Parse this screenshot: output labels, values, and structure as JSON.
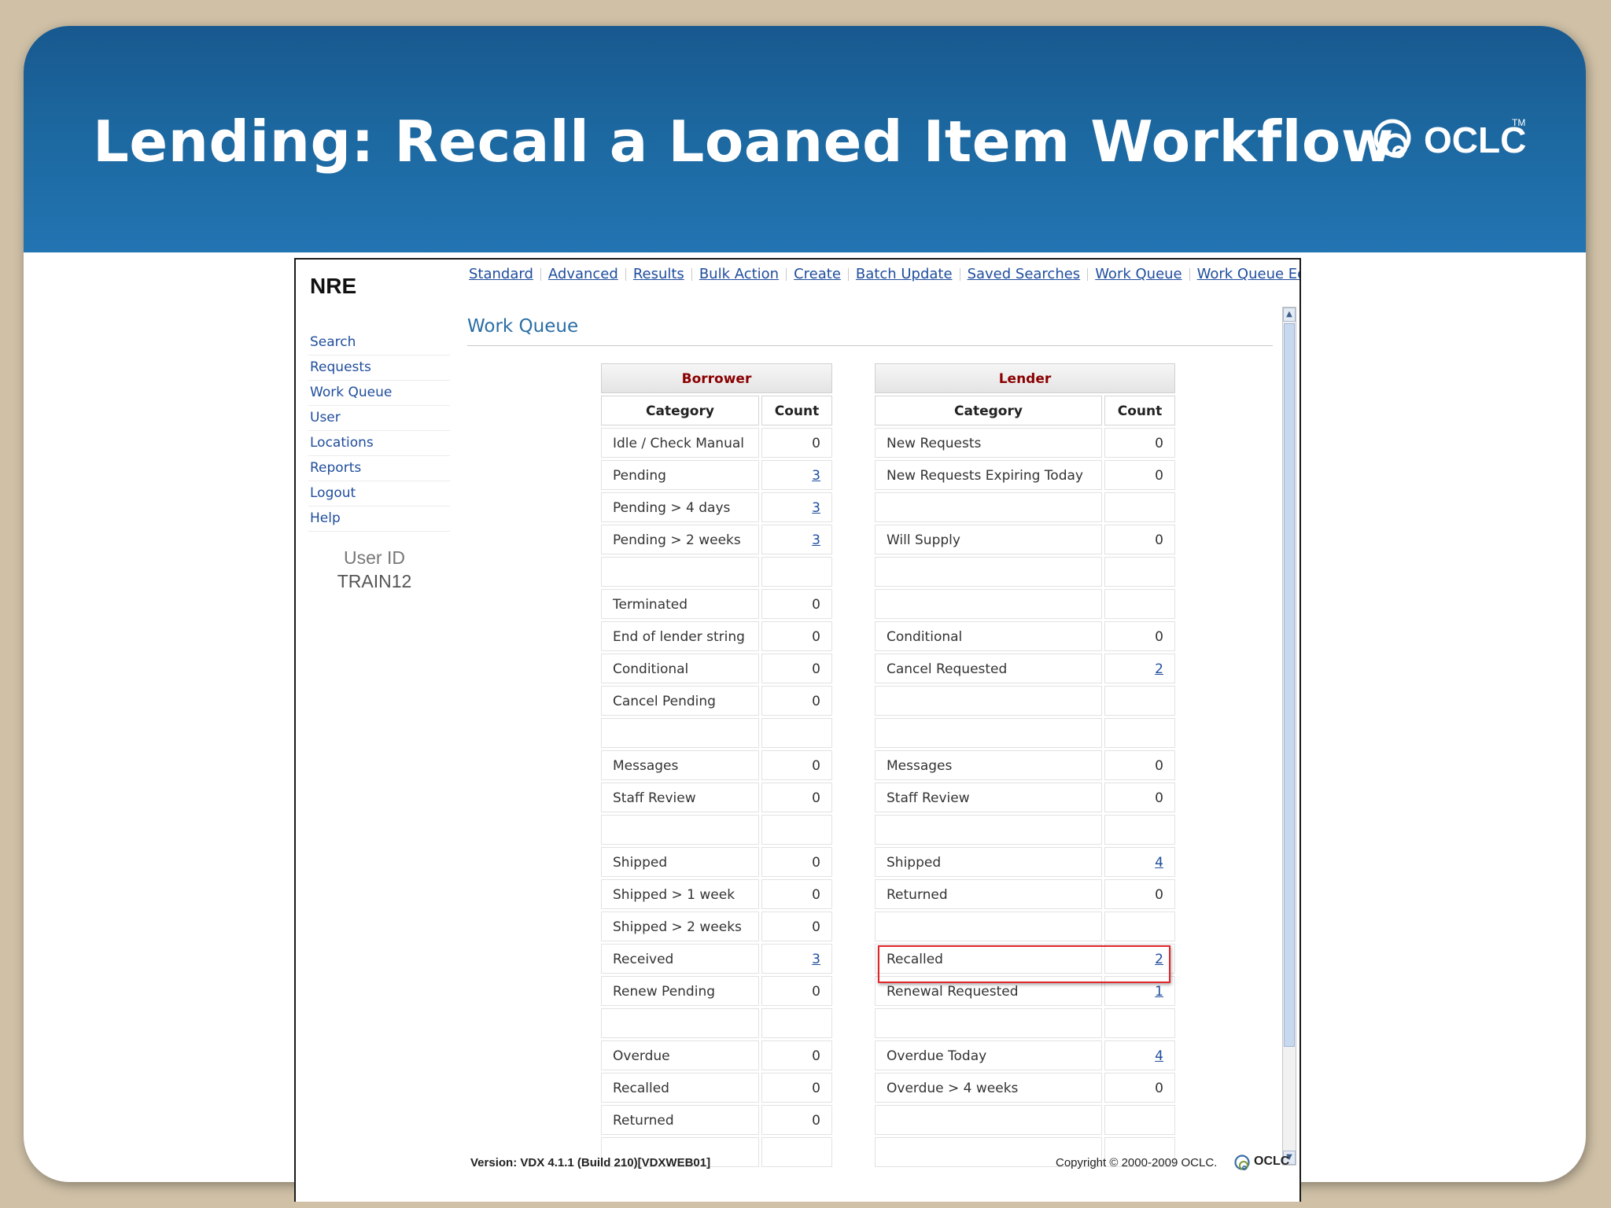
{
  "slide": {
    "title": "Lending: Recall a Loaned Item Workflow",
    "logo_text": "OCLC",
    "logo_tm": "TM"
  },
  "app": {
    "brand": "NRE",
    "top_nav": [
      "Standard",
      "Advanced",
      "Results",
      "Bulk Action",
      "Create",
      "Batch Update",
      "Saved Searches",
      "Work Queue",
      "Work Queue Edit"
    ],
    "side_nav": [
      "Search",
      "Requests",
      "Work Queue",
      "User",
      "Locations",
      "Reports",
      "Logout",
      "Help"
    ],
    "user_id_label": "User ID",
    "user_id": "TRAIN12",
    "page_title": "Work Queue",
    "footer_version": "Version: VDX 4.1.1 (Build 210)[VDXWEB01]",
    "footer_copyright": "Copyright © 2000-2009 OCLC.",
    "footer_logo_text": "OCLC"
  },
  "borrower": {
    "header": "Borrower",
    "col_category": "Category",
    "col_count": "Count",
    "rows": [
      {
        "category": "Idle / Check Manual",
        "count": "0",
        "link": false
      },
      {
        "category": "Pending",
        "count": "3",
        "link": true
      },
      {
        "category": "Pending > 4 days",
        "count": "3",
        "link": true
      },
      {
        "category": "Pending > 2 weeks",
        "count": "3",
        "link": true
      },
      {
        "category": "",
        "count": "",
        "link": false
      },
      {
        "category": "Terminated",
        "count": "0",
        "link": false
      },
      {
        "category": "End of lender string",
        "count": "0",
        "link": false
      },
      {
        "category": "Conditional",
        "count": "0",
        "link": false
      },
      {
        "category": "Cancel Pending",
        "count": "0",
        "link": false
      },
      {
        "category": "",
        "count": "",
        "link": false
      },
      {
        "category": "Messages",
        "count": "0",
        "link": false
      },
      {
        "category": "Staff Review",
        "count": "0",
        "link": false
      },
      {
        "category": "",
        "count": "",
        "link": false
      },
      {
        "category": "Shipped",
        "count": "0",
        "link": false
      },
      {
        "category": "Shipped > 1 week",
        "count": "0",
        "link": false
      },
      {
        "category": "Shipped > 2 weeks",
        "count": "0",
        "link": false
      },
      {
        "category": "Received",
        "count": "3",
        "link": true
      },
      {
        "category": "Renew Pending",
        "count": "0",
        "link": false
      },
      {
        "category": "",
        "count": "",
        "link": false
      },
      {
        "category": "Overdue",
        "count": "0",
        "link": false
      },
      {
        "category": "Recalled",
        "count": "0",
        "link": false
      },
      {
        "category": "Returned",
        "count": "0",
        "link": false
      },
      {
        "category": "",
        "count": "",
        "link": false
      }
    ]
  },
  "lender": {
    "header": "Lender",
    "col_category": "Category",
    "col_count": "Count",
    "rows": [
      {
        "category": "New Requests",
        "count": "0",
        "link": false
      },
      {
        "category": "New Requests Expiring Today",
        "count": "0",
        "link": false
      },
      {
        "category": "",
        "count": "",
        "link": false
      },
      {
        "category": "Will Supply",
        "count": "0",
        "link": false
      },
      {
        "category": "",
        "count": "",
        "link": false
      },
      {
        "category": "",
        "count": "",
        "link": false
      },
      {
        "category": "Conditional",
        "count": "0",
        "link": false
      },
      {
        "category": "Cancel Requested",
        "count": "2",
        "link": true
      },
      {
        "category": "",
        "count": "",
        "link": false
      },
      {
        "category": "",
        "count": "",
        "link": false
      },
      {
        "category": "Messages",
        "count": "0",
        "link": false
      },
      {
        "category": "Staff Review",
        "count": "0",
        "link": false
      },
      {
        "category": "",
        "count": "",
        "link": false
      },
      {
        "category": "Shipped",
        "count": "4",
        "link": true
      },
      {
        "category": "Returned",
        "count": "0",
        "link": false
      },
      {
        "category": "",
        "count": "",
        "link": false
      },
      {
        "category": "Recalled",
        "count": "2",
        "link": true
      },
      {
        "category": "Renewal Requested",
        "count": "1",
        "link": true
      },
      {
        "category": "",
        "count": "",
        "link": false
      },
      {
        "category": "Overdue Today",
        "count": "4",
        "link": true
      },
      {
        "category": "Overdue > 4 weeks",
        "count": "0",
        "link": false
      },
      {
        "category": "",
        "count": "",
        "link": false
      },
      {
        "category": "",
        "count": "",
        "link": false
      }
    ]
  },
  "colors": {
    "banner": "#1d6aa3",
    "link": "#1f4d9c",
    "panel_header_text": "#8b0000",
    "highlight": "#e0262b"
  }
}
